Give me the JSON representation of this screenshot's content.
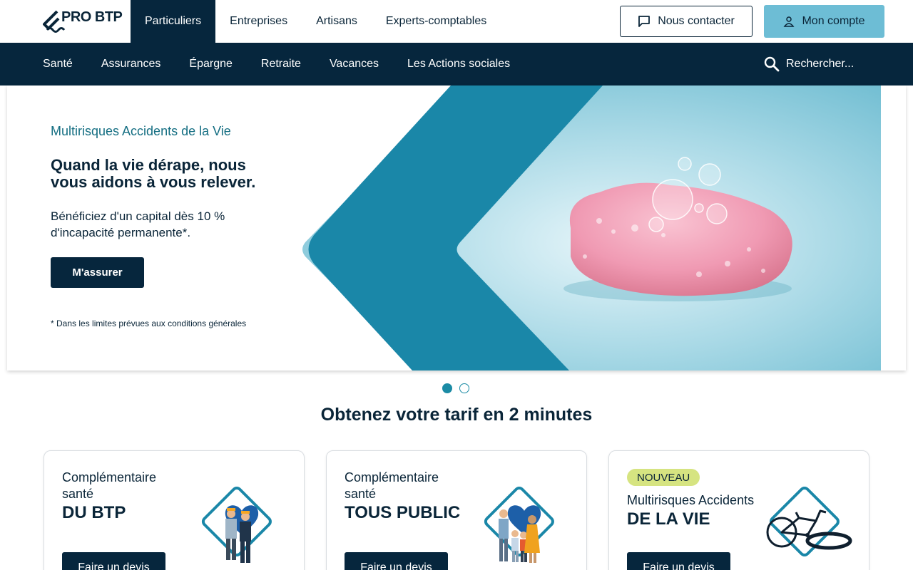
{
  "brand": {
    "logo_text": "PRO BTP"
  },
  "audience_tabs": [
    {
      "label": "Particuliers",
      "active": true
    },
    {
      "label": "Entreprises",
      "active": false
    },
    {
      "label": "Artisans",
      "active": false
    },
    {
      "label": "Experts-comptables",
      "active": false
    }
  ],
  "header_buttons": {
    "contact_label": "Nous contacter",
    "contact_icon": "chat-bubble-icon",
    "account_label": "Mon compte",
    "account_icon": "user-icon"
  },
  "main_nav": [
    "Santé",
    "Assurances",
    "Épargne",
    "Retraite",
    "Vacances",
    "Les Actions sociales"
  ],
  "search": {
    "placeholder": "Rechercher...",
    "icon": "search-icon"
  },
  "hero": {
    "kicker": "Multirisques Accidents de la Vie",
    "title": "Quand la vie dérape, nous vous aidons à vous relever.",
    "description": "Bénéficiez d'un capital dès 10 % d'incapacité permanente*.",
    "cta_label": "M'assurer",
    "footnote": "* Dans les limites prévues aux conditions générales",
    "image": "pink-soap-with-bubbles"
  },
  "carousel": {
    "slides": 2,
    "active_index": 0
  },
  "quote_section": {
    "title": "Obtenez votre tarif en 2 minutes",
    "cards": [
      {
        "badge": "",
        "subtitle": "Complémentaire santé",
        "title": "DU BTP",
        "cta_label": "Faire un devis",
        "illustration": "construction-workers-heart"
      },
      {
        "badge": "",
        "subtitle": "Complémentaire santé",
        "title": "TOUS PUBLIC",
        "cta_label": "Faire un devis",
        "illustration": "family-heart"
      },
      {
        "badge": "NOUVEAU",
        "subtitle": "Multirisques Accidents",
        "title": "DE LA VIE",
        "cta_label": "Faire un devis",
        "illustration": "broken-bicycle"
      }
    ]
  },
  "colors": {
    "navy": "#06263d",
    "teal": "#1b8ba5",
    "light_blue": "#6dbdd5",
    "badge_green": "#d6e481"
  }
}
